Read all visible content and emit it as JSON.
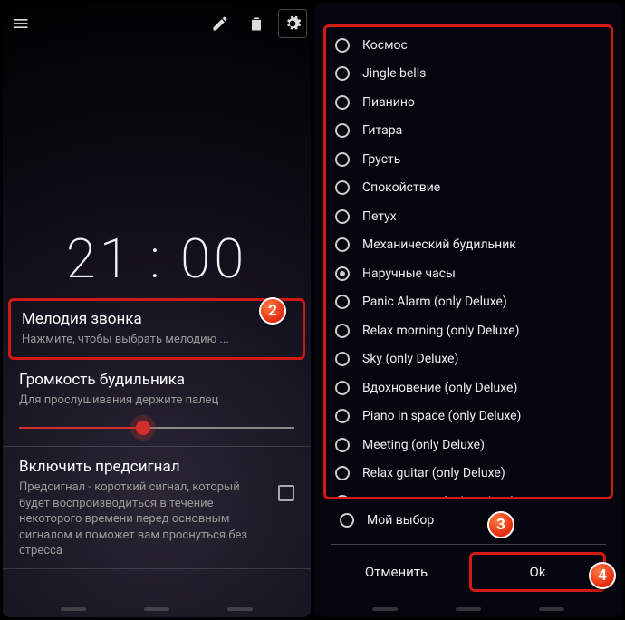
{
  "left": {
    "clock_time": "21 : 00",
    "ringtone": {
      "title": "Мелодия звонка",
      "subtitle": "Нажмите, чтобы выбрать мелодию ..."
    },
    "volume": {
      "title": "Громкость будильника",
      "subtitle": "Для прослушивания держите палец"
    },
    "presignal": {
      "title": "Включить предсигнал",
      "subtitle": "Предсигнал - короткий сигнал, который будет воспроизводиться в течение некоторого времени перед основным сигналом и поможет вам проснуться без стресса"
    }
  },
  "right": {
    "options": [
      "Космос",
      "Jingle bells",
      "Пианино",
      "Гитара",
      "Грусть",
      "Спокойствие",
      "Петух",
      "Механический будильник",
      "Наручные часы",
      "Panic Alarm (only Deluxe)",
      "Relax morning (only Deluxe)",
      "Sky (only Deluxe)",
      "Вдохновение (only Deluxe)",
      "Piano in space (only Deluxe)",
      "Meeting (only Deluxe)",
      "Relax guitar (only Deluxe)",
      "Зелёный лес (only Deluxe)"
    ],
    "selected_index": 8,
    "my_choice": "Мой выбор",
    "cancel": "Отменить",
    "ok": "Ok"
  },
  "badges": {
    "b2": "2",
    "b3": "3",
    "b4": "4"
  }
}
